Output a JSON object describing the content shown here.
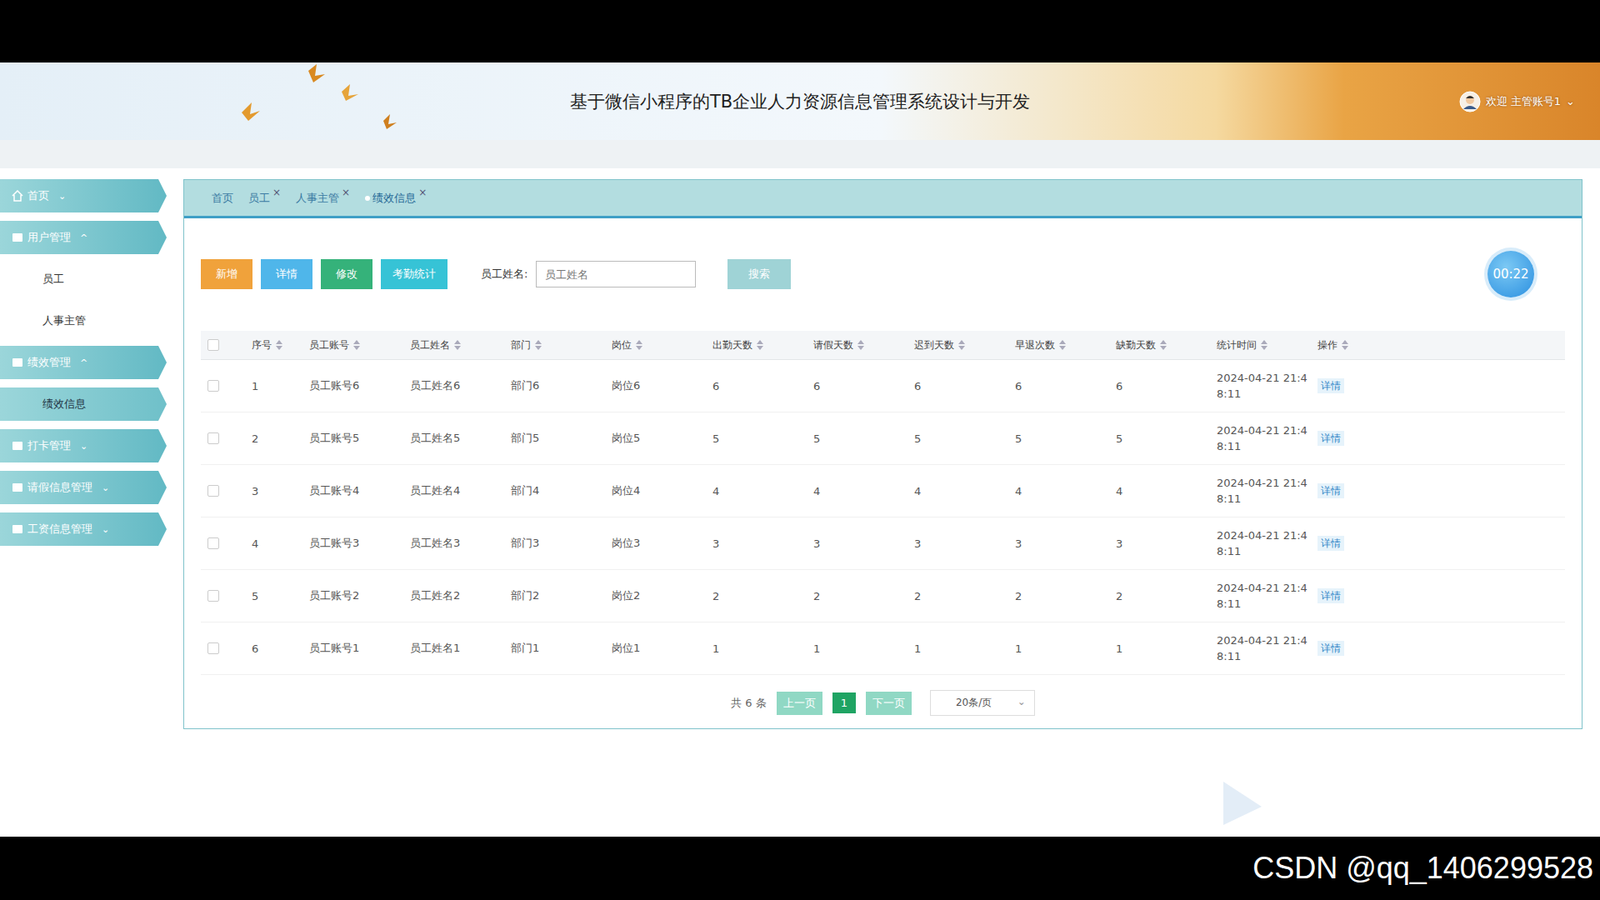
{
  "window": {
    "title": "基于微信小程序的TB企业人力资源信息管理系统设计与开发"
  },
  "user": {
    "greeting": "欢迎 主管账号1",
    "caret": "⌄"
  },
  "sidebar": {
    "items": [
      {
        "label": "首页",
        "caret": "⌄",
        "expanded": false,
        "children": []
      },
      {
        "label": "用户管理",
        "caret": "^",
        "expanded": true,
        "children": [
          {
            "label": "员工",
            "selected": false
          },
          {
            "label": "人事主管",
            "selected": false
          }
        ]
      },
      {
        "label": "绩效管理",
        "caret": "^",
        "expanded": true,
        "children": [
          {
            "label": "绩效信息",
            "selected": true
          }
        ]
      },
      {
        "label": "打卡管理",
        "caret": "⌄",
        "expanded": false,
        "children": []
      },
      {
        "label": "请假信息管理",
        "caret": "⌄",
        "expanded": false,
        "children": []
      },
      {
        "label": "工资信息管理",
        "caret": "⌄",
        "expanded": false,
        "children": []
      }
    ]
  },
  "tabs": [
    {
      "label": "首页",
      "selected": false,
      "close": ""
    },
    {
      "label": "员工",
      "selected": false,
      "close": "×"
    },
    {
      "label": "人事主管",
      "selected": false,
      "close": "×"
    },
    {
      "label": "绩效信息",
      "selected": true,
      "close": "×"
    }
  ],
  "toolbar": {
    "buttons": [
      {
        "label": "新增",
        "color": "#f0a23b"
      },
      {
        "label": "详情",
        "color": "#4fb6ea"
      },
      {
        "label": "修改",
        "color": "#35b27a"
      },
      {
        "label": "考勤统计",
        "color": "#36c3d6"
      }
    ],
    "search_label": "员工姓名:",
    "search_placeholder": "员工姓名",
    "search_button": "搜索"
  },
  "timer": "00:22",
  "table": {
    "header_checked": false,
    "columns": [
      {
        "label": "序号",
        "sortable": true
      },
      {
        "label": "员工账号",
        "sortable": true
      },
      {
        "label": "员工姓名",
        "sortable": true
      },
      {
        "label": "部门",
        "sortable": true
      },
      {
        "label": "岗位",
        "sortable": true
      },
      {
        "label": "出勤天数",
        "sortable": true
      },
      {
        "label": "请假天数",
        "sortable": true
      },
      {
        "label": "迟到天数",
        "sortable": true
      },
      {
        "label": "早退次数",
        "sortable": true
      },
      {
        "label": "缺勤天数",
        "sortable": true
      },
      {
        "label": "统计时间",
        "sortable": true
      },
      {
        "label": "操作",
        "sortable": true
      }
    ],
    "rows": [
      {
        "checked": false,
        "cells": [
          "1",
          "员工账号6",
          "员工姓名6",
          "部门6",
          "岗位6",
          "6",
          "6",
          "6",
          "6",
          "6",
          "2024-04-21 21:48:11"
        ],
        "action": "详情"
      },
      {
        "checked": false,
        "cells": [
          "2",
          "员工账号5",
          "员工姓名5",
          "部门5",
          "岗位5",
          "5",
          "5",
          "5",
          "5",
          "5",
          "2024-04-21 21:48:11"
        ],
        "action": "详情"
      },
      {
        "checked": false,
        "cells": [
          "3",
          "员工账号4",
          "员工姓名4",
          "部门4",
          "岗位4",
          "4",
          "4",
          "4",
          "4",
          "4",
          "2024-04-21 21:48:11"
        ],
        "action": "详情"
      },
      {
        "checked": false,
        "cells": [
          "4",
          "员工账号3",
          "员工姓名3",
          "部门3",
          "岗位3",
          "3",
          "3",
          "3",
          "3",
          "3",
          "2024-04-21 21:48:11"
        ],
        "action": "详情"
      },
      {
        "checked": false,
        "cells": [
          "5",
          "员工账号2",
          "员工姓名2",
          "部门2",
          "岗位2",
          "2",
          "2",
          "2",
          "2",
          "2",
          "2024-04-21 21:48:11"
        ],
        "action": "详情"
      },
      {
        "checked": false,
        "cells": [
          "6",
          "员工账号1",
          "员工姓名1",
          "部门1",
          "岗位1",
          "1",
          "1",
          "1",
          "1",
          "1",
          "2024-04-21 21:48:11"
        ],
        "action": "详情"
      }
    ]
  },
  "pagination": {
    "total": "共 6 条",
    "prev": "上一页",
    "pages": [
      {
        "label": "1",
        "selected": true
      }
    ],
    "next": "下一页",
    "size": "20条/页",
    "caret": "⌄"
  },
  "watermark": "CSDN @qq_1406299528"
}
